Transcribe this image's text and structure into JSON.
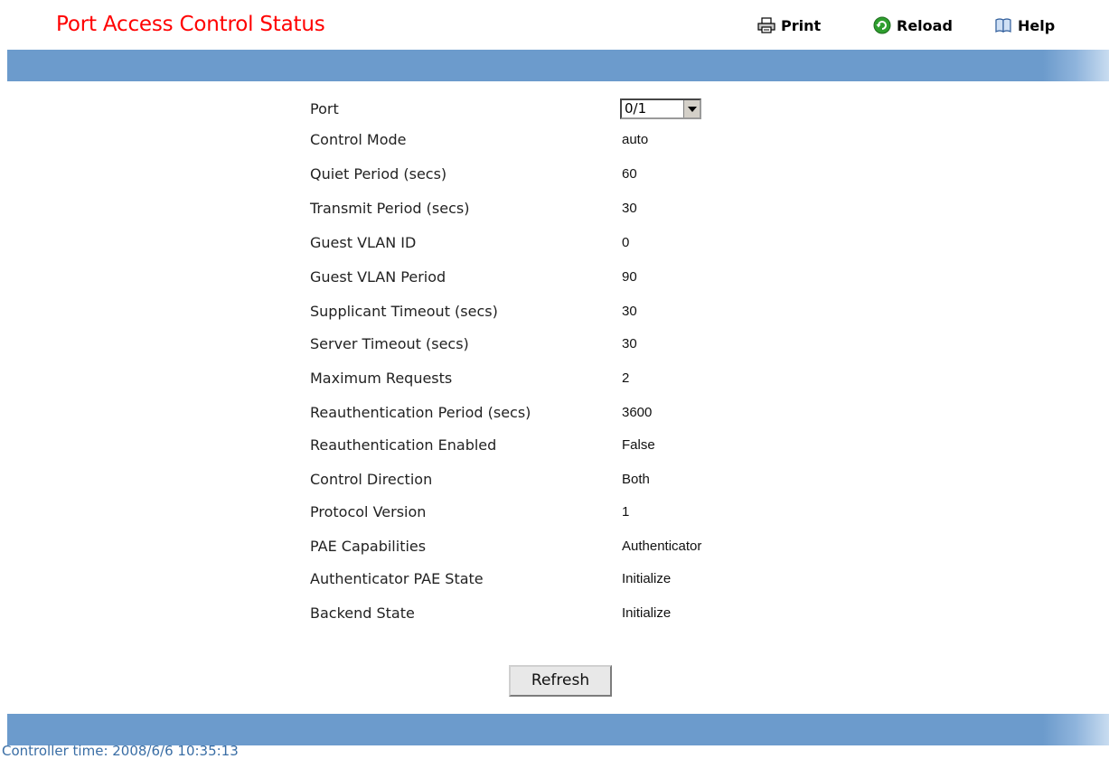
{
  "header": {
    "title": "Port Access Control Status",
    "print_label": "Print",
    "reload_label": "Reload",
    "help_label": "Help"
  },
  "form": {
    "fields": [
      {
        "label": "Port",
        "value": "0/1"
      },
      {
        "label": "Control Mode",
        "value": "auto"
      },
      {
        "label": "Quiet Period (secs)",
        "value": "60"
      },
      {
        "label": "Transmit Period (secs)",
        "value": "30"
      },
      {
        "label": "Guest VLAN ID",
        "value": "0"
      },
      {
        "label": "Guest VLAN Period",
        "value": "90"
      },
      {
        "label": "Supplicant Timeout (secs)",
        "value": "30"
      },
      {
        "label": "Server Timeout (secs)",
        "value": "30"
      },
      {
        "label": "Maximum Requests",
        "value": "2"
      },
      {
        "label": "Reauthentication Period (secs)",
        "value": "3600"
      },
      {
        "label": "Reauthentication Enabled",
        "value": "False"
      },
      {
        "label": "Control Direction",
        "value": "Both"
      },
      {
        "label": "Protocol Version",
        "value": "1"
      },
      {
        "label": "PAE Capabilities",
        "value": "Authenticator"
      },
      {
        "label": "Authenticator PAE State",
        "value": "Initialize"
      },
      {
        "label": "Backend State",
        "value": "Initialize"
      }
    ]
  },
  "actions": {
    "refresh_label": "Refresh"
  },
  "footer": {
    "controller_time": "Controller time: 2008/6/6 10:35:13"
  },
  "colors": {
    "title": "#ff0000",
    "bar": "#6c9bcc",
    "footer_text": "#3a6ea5"
  }
}
